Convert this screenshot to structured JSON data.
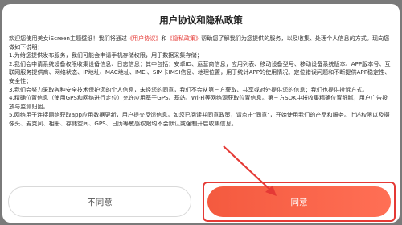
{
  "dialog": {
    "title": "用户协议和隐私政策",
    "intro_prefix": "欢迎您使用美女iScreen主题壁纸！我们将通过",
    "link_user_agreement": "《用户协议》",
    "and": "和",
    "link_privacy_policy": "《隐私政策》",
    "intro_suffix": "帮助您了解我们为您提供的服务，以及收集、处理个人信息的方式。现向您做如下说明：",
    "items": [
      "1.为给您提供发布服务，我们可能会申请手机存储权限，用于数据采集存储；",
      "2.我们会申请系统设备权限收集设备信息、日志信息：其中包括：安卓ID、运营商信息，应用列表、移动设备型号、移动设备系统版本、APP版本号、互联网服务提供商、网络状态、IP地址、MAC地址、IMEI、SIM卡IMSI信息、地理位置，用于统计APP的使用情况、定位错误问题和不断提供APP稳定性、安全性；",
      "3.我们会努力采取各种安全技术保护您的个人信息，未经您的同意，我们不会从第三方获取、共享或对外提供您的信息；我们也提供投诉方式。",
      "4.精确位置信息（使用GPS和网络进行定位）允许应用基于GPS、基站、Wi-Fi等网络源获取位置信息。第三方SDK中将收集精确位置细腻，用户广告投放与监测归因。",
      "5.网络用于连接网络获取app应用数据更新，用户提交反馈信息。如您已阅读并同意政策，请点击\"同意\"，开始使用我们的产品和服务。上述权限以及摄像头、麦克风、相册、存储空间、GPS、日历等敏感权限均不会默认或强制开启收集信息。"
    ],
    "disagree_label": "不同意",
    "agree_label": "同意"
  },
  "colors": {
    "accent": "#f45a3f",
    "link": "#e53935"
  }
}
